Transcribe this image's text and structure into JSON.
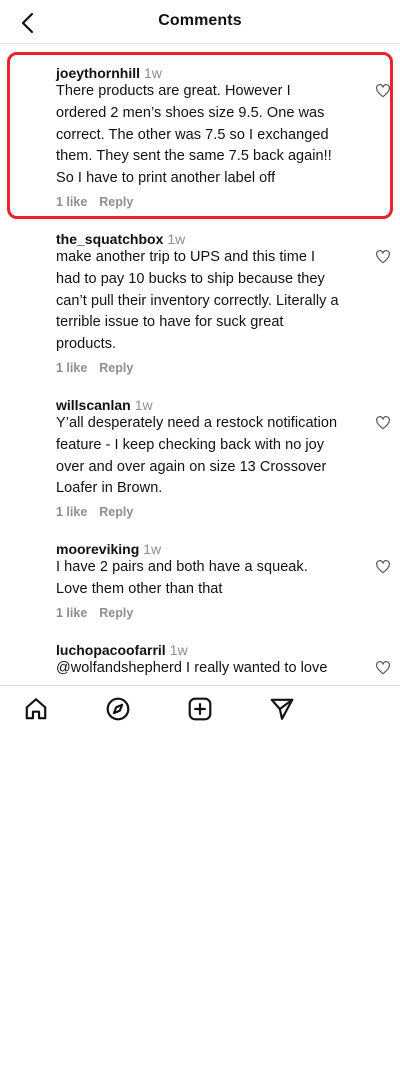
{
  "header": {
    "title": "Comments",
    "back_icon": "chevron-left-icon"
  },
  "comments": [
    {
      "username": "joeythornhill",
      "time": "1w",
      "text": "There products are great. However I ordered 2 men’s shoes size 9.5. One was correct. The other was 7.5 so I exchanged them. They sent the same 7.5 back again!! So I have to print another label off",
      "likes": "1 like",
      "reply": "Reply",
      "highlighted": true
    },
    {
      "username": "the_squatchbox",
      "time": "1w",
      "text": "make another trip to UPS and this time I had to pay 10 bucks to ship because they can’t pull their inventory correctly. Literally a terrible issue to have for suck great products.",
      "likes": "1 like",
      "reply": "Reply"
    },
    {
      "username": "willscanlan",
      "time": "1w",
      "text": "Y’all desperately need a restock notification feature - I keep checking back with no joy over and over again on size 13 Crossover Loafer in Brown.",
      "likes": "1 like",
      "reply": "Reply"
    },
    {
      "username": "mooreviking",
      "time": "1w",
      "text": "I have 2 pairs and both have a squeak. Love them other than that",
      "likes": "1 like",
      "reply": "Reply"
    },
    {
      "username": "luchopacoofarril",
      "time": "1w",
      "text": "@wolfandshepherd I really wanted to love",
      "likes": "",
      "reply": ""
    }
  ],
  "bottom_nav": [
    {
      "icon": "home-icon"
    },
    {
      "icon": "explore-compass-icon"
    },
    {
      "icon": "new-post-plus-icon"
    },
    {
      "icon": "send-paper-plane-icon"
    }
  ],
  "colors": {
    "highlight": "#e8232d",
    "text": "#111111",
    "secondary": "#8e8e8e"
  }
}
